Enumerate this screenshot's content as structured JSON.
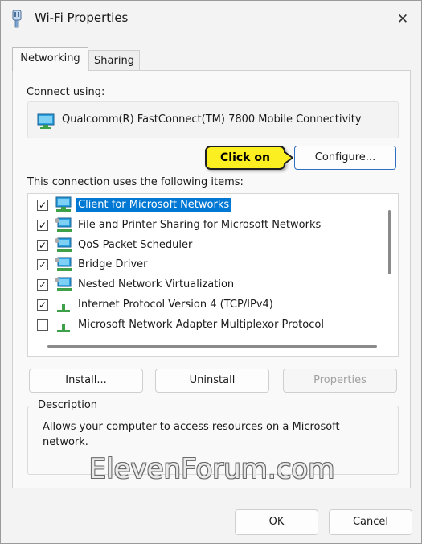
{
  "window": {
    "title": "Wi-Fi Properties",
    "close_glyph": "✕"
  },
  "tabs": [
    {
      "label": "Networking"
    },
    {
      "label": "Sharing"
    }
  ],
  "connect": {
    "label": "Connect using:",
    "adapter_name": "Qualcomm(R) FastConnect(TM) 7800 Mobile Connectivity",
    "configure_label": "Configure..."
  },
  "callout": {
    "text": "Click on"
  },
  "items_label": "This connection uses the following items:",
  "items": [
    {
      "label": "Client for Microsoft Networks",
      "checked": true,
      "selected": true,
      "icon": "network-client-icon"
    },
    {
      "label": "File and Printer Sharing for Microsoft Networks",
      "checked": true,
      "selected": false,
      "icon": "network-service-icon"
    },
    {
      "label": "QoS Packet Scheduler",
      "checked": true,
      "selected": false,
      "icon": "network-service-icon"
    },
    {
      "label": "Bridge Driver",
      "checked": true,
      "selected": false,
      "icon": "network-service-icon"
    },
    {
      "label": "Nested Network Virtualization",
      "checked": true,
      "selected": false,
      "icon": "network-service-icon"
    },
    {
      "label": "Internet Protocol Version 4 (TCP/IPv4)",
      "checked": true,
      "selected": false,
      "icon": "protocol-icon"
    },
    {
      "label": "Microsoft Network Adapter Multiplexor Protocol",
      "checked": false,
      "selected": false,
      "icon": "protocol-icon"
    }
  ],
  "buttons": {
    "install": "Install...",
    "uninstall": "Uninstall",
    "properties": "Properties",
    "ok": "OK",
    "cancel": "Cancel"
  },
  "description": {
    "title": "Description",
    "text": "Allows your computer to access resources on a Microsoft network."
  },
  "watermark": "ElevenForum.com",
  "colors": {
    "selection": "#0078d4",
    "callout": "#fbee21",
    "primary_border": "#2f6fbf"
  }
}
